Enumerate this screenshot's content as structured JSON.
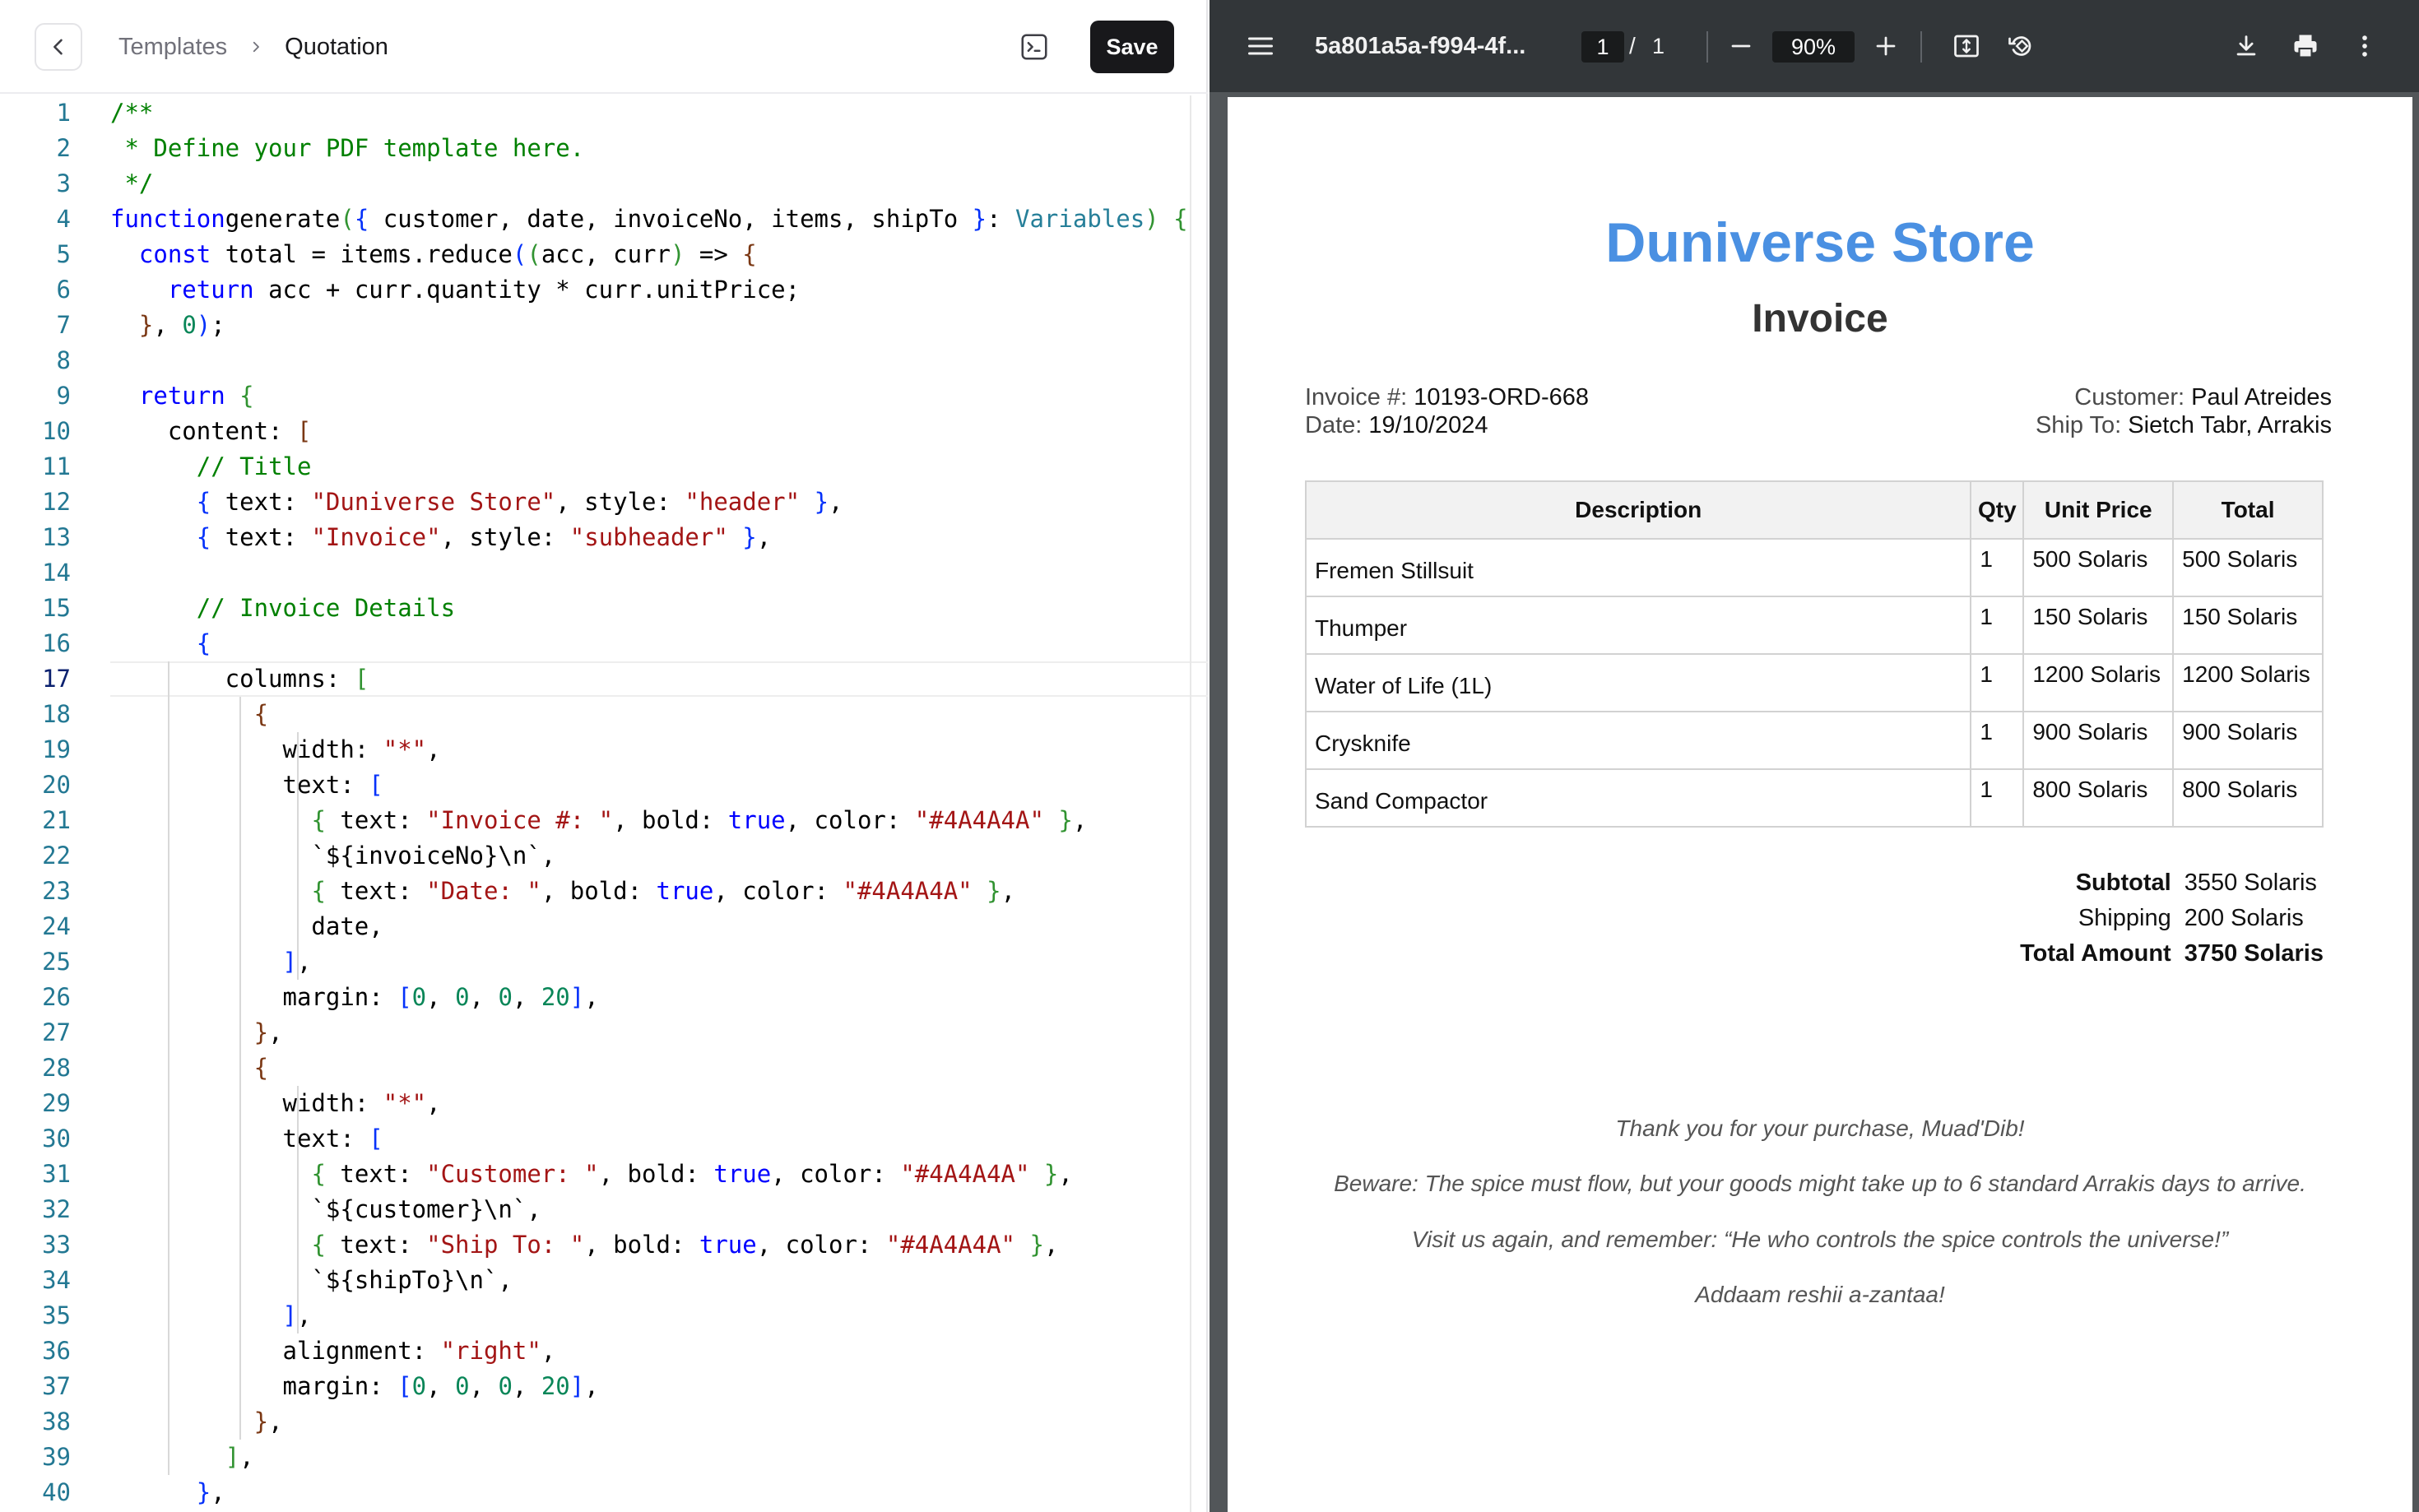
{
  "breadcrumb": {
    "parent": "Templates",
    "current": "Quotation"
  },
  "toolbar": {
    "save_label": "Save"
  },
  "editor": {
    "active_line": 17,
    "lines": [
      {
        "n": "1"
      },
      {
        "n": "2"
      },
      {
        "n": "3"
      },
      {
        "n": "4"
      },
      {
        "n": "5"
      },
      {
        "n": "6"
      },
      {
        "n": "7"
      },
      {
        "n": "8"
      },
      {
        "n": "9"
      },
      {
        "n": "10"
      },
      {
        "n": "11"
      },
      {
        "n": "12"
      },
      {
        "n": "13"
      },
      {
        "n": "14"
      },
      {
        "n": "15"
      },
      {
        "n": "16"
      },
      {
        "n": "17"
      },
      {
        "n": "18"
      },
      {
        "n": "19"
      },
      {
        "n": "20"
      },
      {
        "n": "21"
      },
      {
        "n": "22"
      },
      {
        "n": "23"
      },
      {
        "n": "24"
      },
      {
        "n": "25"
      },
      {
        "n": "26"
      },
      {
        "n": "27"
      },
      {
        "n": "28"
      },
      {
        "n": "29"
      },
      {
        "n": "30"
      },
      {
        "n": "31"
      },
      {
        "n": "32"
      },
      {
        "n": "33"
      },
      {
        "n": "34"
      },
      {
        "n": "35"
      },
      {
        "n": "36"
      },
      {
        "n": "37"
      },
      {
        "n": "38"
      },
      {
        "n": "39"
      },
      {
        "n": "40"
      }
    ],
    "code": [
      [
        [
          "cm",
          "/**"
        ]
      ],
      [
        [
          "cm",
          " * Define your PDF template here."
        ]
      ],
      [
        [
          "cm",
          " */"
        ]
      ],
      [
        [
          "kw",
          "function"
        ],
        [
          "",
          "generate"
        ],
        [
          "b2",
          "("
        ],
        [
          "b1",
          "{"
        ],
        [
          "",
          " customer, date, invoiceNo, items, shipTo "
        ],
        [
          "b1",
          "}"
        ],
        [
          "",
          ": "
        ],
        [
          "ty",
          "Variables"
        ],
        [
          "b2",
          ")"
        ],
        [
          "",
          " "
        ],
        [
          "b2",
          "{"
        ]
      ],
      [
        [
          "",
          "  "
        ],
        [
          "kw",
          "const"
        ],
        [
          "",
          " total = items.reduce"
        ],
        [
          "b1",
          "("
        ],
        [
          "b2",
          "("
        ],
        [
          "",
          "acc, curr"
        ],
        [
          "b2",
          ")"
        ],
        [
          "",
          " => "
        ],
        [
          "b3",
          "{"
        ]
      ],
      [
        [
          "",
          "    "
        ],
        [
          "kw",
          "return"
        ],
        [
          "",
          " acc + curr.quantity * curr.unitPrice;"
        ]
      ],
      [
        [
          "",
          "  "
        ],
        [
          "b3",
          "}"
        ],
        [
          "",
          ", "
        ],
        [
          "nm",
          "0"
        ],
        [
          "b1",
          ")"
        ],
        [
          "",
          ";"
        ]
      ],
      [
        [
          "",
          ""
        ]
      ],
      [
        [
          "",
          "  "
        ],
        [
          "kw",
          "return"
        ],
        [
          "",
          " "
        ],
        [
          "b2",
          "{"
        ]
      ],
      [
        [
          "",
          "    content: "
        ],
        [
          "b3",
          "["
        ]
      ],
      [
        [
          "",
          "      "
        ],
        [
          "cm",
          "// Title"
        ]
      ],
      [
        [
          "",
          "      "
        ],
        [
          "b1",
          "{"
        ],
        [
          "",
          " text: "
        ],
        [
          "st",
          "\"Duniverse Store\""
        ],
        [
          "",
          ", style: "
        ],
        [
          "st",
          "\"header\""
        ],
        [
          "",
          " "
        ],
        [
          "b1",
          "}"
        ],
        [
          "",
          ","
        ]
      ],
      [
        [
          "",
          "      "
        ],
        [
          "b1",
          "{"
        ],
        [
          "",
          " text: "
        ],
        [
          "st",
          "\"Invoice\""
        ],
        [
          "",
          ", style: "
        ],
        [
          "st",
          "\"subheader\""
        ],
        [
          "",
          " "
        ],
        [
          "b1",
          "}"
        ],
        [
          "",
          ","
        ]
      ],
      [
        [
          "",
          ""
        ]
      ],
      [
        [
          "",
          "      "
        ],
        [
          "cm",
          "// Invoice Details"
        ]
      ],
      [
        [
          "",
          "      "
        ],
        [
          "b1",
          "{"
        ]
      ],
      [
        [
          "",
          "        columns: "
        ],
        [
          "b2",
          "["
        ]
      ],
      [
        [
          "",
          "          "
        ],
        [
          "b3",
          "{"
        ]
      ],
      [
        [
          "",
          "            width: "
        ],
        [
          "st",
          "\"*\""
        ],
        [
          "",
          ","
        ]
      ],
      [
        [
          "",
          "            text: "
        ],
        [
          "b1",
          "["
        ]
      ],
      [
        [
          "",
          "              "
        ],
        [
          "b2",
          "{"
        ],
        [
          "",
          " text: "
        ],
        [
          "st",
          "\"Invoice #: \""
        ],
        [
          "",
          ", bold: "
        ],
        [
          "kw",
          "true"
        ],
        [
          "",
          ", color: "
        ],
        [
          "st",
          "\"#4A4A4A\""
        ],
        [
          "",
          " "
        ],
        [
          "b2",
          "}"
        ],
        [
          "",
          ","
        ]
      ],
      [
        [
          "",
          "              `${"
        ],
        [
          "",
          "invoiceNo"
        ],
        [
          "",
          "}\\n`,"
        ]
      ],
      [
        [
          "",
          "              "
        ],
        [
          "b2",
          "{"
        ],
        [
          "",
          " text: "
        ],
        [
          "st",
          "\"Date: \""
        ],
        [
          "",
          ", bold: "
        ],
        [
          "kw",
          "true"
        ],
        [
          "",
          ", color: "
        ],
        [
          "st",
          "\"#4A4A4A\""
        ],
        [
          "",
          " "
        ],
        [
          "b2",
          "}"
        ],
        [
          "",
          ","
        ]
      ],
      [
        [
          "",
          "              date,"
        ]
      ],
      [
        [
          "",
          "            "
        ],
        [
          "b1",
          "]"
        ],
        [
          "",
          ","
        ]
      ],
      [
        [
          "",
          "            margin: "
        ],
        [
          "b1",
          "["
        ],
        [
          "nm",
          "0"
        ],
        [
          "",
          ", "
        ],
        [
          "nm",
          "0"
        ],
        [
          "",
          ", "
        ],
        [
          "nm",
          "0"
        ],
        [
          "",
          ", "
        ],
        [
          "nm",
          "20"
        ],
        [
          "b1",
          "]"
        ],
        [
          "",
          ","
        ]
      ],
      [
        [
          "",
          "          "
        ],
        [
          "b3",
          "}"
        ],
        [
          "",
          ","
        ]
      ],
      [
        [
          "",
          "          "
        ],
        [
          "b3",
          "{"
        ]
      ],
      [
        [
          "",
          "            width: "
        ],
        [
          "st",
          "\"*\""
        ],
        [
          "",
          ","
        ]
      ],
      [
        [
          "",
          "            text: "
        ],
        [
          "b1",
          "["
        ]
      ],
      [
        [
          "",
          "              "
        ],
        [
          "b2",
          "{"
        ],
        [
          "",
          " text: "
        ],
        [
          "st",
          "\"Customer: \""
        ],
        [
          "",
          ", bold: "
        ],
        [
          "kw",
          "true"
        ],
        [
          "",
          ", color: "
        ],
        [
          "st",
          "\"#4A4A4A\""
        ],
        [
          "",
          " "
        ],
        [
          "b2",
          "}"
        ],
        [
          "",
          ","
        ]
      ],
      [
        [
          "",
          "              `${"
        ],
        [
          "",
          "customer"
        ],
        [
          "",
          "}\\n`,"
        ]
      ],
      [
        [
          "",
          "              "
        ],
        [
          "b2",
          "{"
        ],
        [
          "",
          " text: "
        ],
        [
          "st",
          "\"Ship To: \""
        ],
        [
          "",
          ", bold: "
        ],
        [
          "kw",
          "true"
        ],
        [
          "",
          ", color: "
        ],
        [
          "st",
          "\"#4A4A4A\""
        ],
        [
          "",
          " "
        ],
        [
          "b2",
          "}"
        ],
        [
          "",
          ","
        ]
      ],
      [
        [
          "",
          "              `${"
        ],
        [
          "",
          "shipTo"
        ],
        [
          "",
          "}\\n`,"
        ]
      ],
      [
        [
          "",
          "            "
        ],
        [
          "b1",
          "]"
        ],
        [
          "",
          ","
        ]
      ],
      [
        [
          "",
          "            alignment: "
        ],
        [
          "st",
          "\"right\""
        ],
        [
          "",
          ","
        ]
      ],
      [
        [
          "",
          "            margin: "
        ],
        [
          "b1",
          "["
        ],
        [
          "nm",
          "0"
        ],
        [
          "",
          ", "
        ],
        [
          "nm",
          "0"
        ],
        [
          "",
          ", "
        ],
        [
          "nm",
          "0"
        ],
        [
          "",
          ", "
        ],
        [
          "nm",
          "20"
        ],
        [
          "b1",
          "]"
        ],
        [
          "",
          ","
        ]
      ],
      [
        [
          "",
          "          "
        ],
        [
          "b3",
          "}"
        ],
        [
          "",
          ","
        ]
      ],
      [
        [
          "",
          "        "
        ],
        [
          "b2",
          "]"
        ],
        [
          "",
          ","
        ]
      ],
      [
        [
          "",
          "      "
        ],
        [
          "b1",
          "}"
        ],
        [
          "",
          ","
        ]
      ]
    ]
  },
  "viewer": {
    "doc_title": "5a801a5a-f994-4f...",
    "page_current": "1",
    "page_sep": "/",
    "page_total": "1",
    "zoom": "90%"
  },
  "invoice": {
    "store": "Duniverse Store",
    "heading": "Invoice",
    "invoice_label": "Invoice #:",
    "invoice_no": "10193-ORD-668",
    "date_label": "Date:",
    "date": "19/10/2024",
    "customer_label": "Customer:",
    "customer": "Paul Atreides",
    "ship_label": "Ship To:",
    "ship_to": "Sietch Tabr, Arrakis",
    "columns": [
      "Description",
      "Qty",
      "Unit Price",
      "Total"
    ],
    "rows": [
      {
        "desc": "Fremen Stillsuit",
        "qty": "1",
        "unit": "500 Solaris",
        "total": "500 Solaris"
      },
      {
        "desc": "Thumper",
        "qty": "1",
        "unit": "150 Solaris",
        "total": "150 Solaris"
      },
      {
        "desc": "Water of Life (1L)",
        "qty": "1",
        "unit": "1200 Solaris",
        "total": "1200 Solaris"
      },
      {
        "desc": "Crysknife",
        "qty": "1",
        "unit": "900 Solaris",
        "total": "900 Solaris"
      },
      {
        "desc": "Sand Compactor",
        "qty": "1",
        "unit": "800 Solaris",
        "total": "800 Solaris"
      }
    ],
    "subtotal_label": "Subtotal",
    "subtotal": "3550 Solaris",
    "shipping_label": "Shipping",
    "shipping": "200 Solaris",
    "total_label": "Total Amount",
    "total": "3750 Solaris",
    "notes": [
      "Thank you for your purchase, Muad'Dib!",
      "Beware: The spice must flow, but your goods might take up to 6 standard Arrakis days to arrive.",
      "Visit us again, and remember: “He who controls the spice controls the universe!”",
      "Addaam reshii a-zantaa!"
    ]
  }
}
